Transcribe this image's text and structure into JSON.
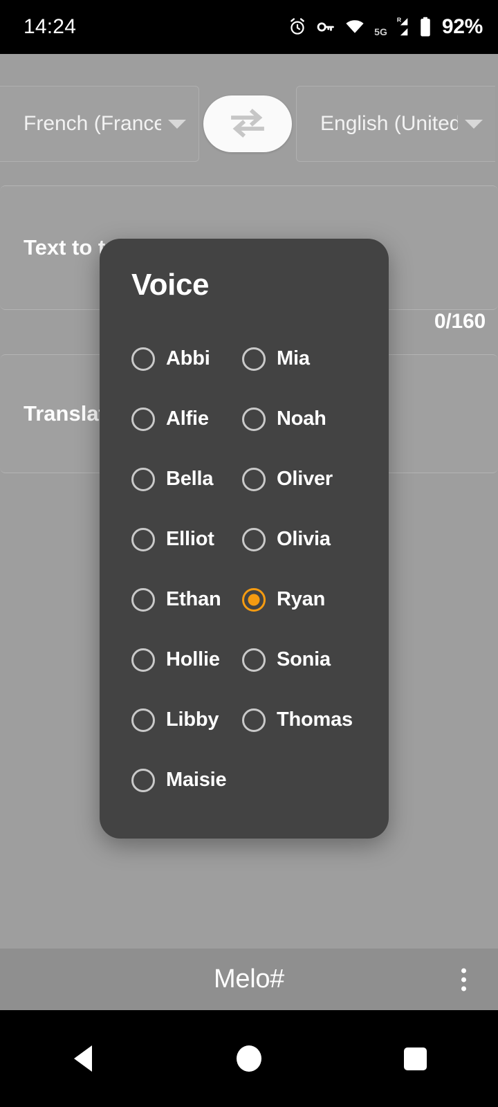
{
  "status_bar": {
    "time": "14:24",
    "battery_percent": "92%",
    "network_label": "5G",
    "roaming_label": "R",
    "icons": [
      "alarm-icon",
      "vpn-key-icon",
      "wifi-icon",
      "signal-5g-icon",
      "battery-icon"
    ]
  },
  "language_bar": {
    "source_language": "French (France)",
    "target_language": "English (United States)",
    "swap_icon": "swap-horizontal-icon"
  },
  "editor": {
    "source_placeholder": "Text to translate",
    "target_placeholder": "Translation",
    "char_counter": "0/160"
  },
  "dialog": {
    "title": "Voice",
    "selected_voice": "Ryan",
    "accent_color": "#f59b11",
    "background_color": "#434343",
    "voices": [
      {
        "label": "Abbi",
        "selected": false
      },
      {
        "label": "Mia",
        "selected": false
      },
      {
        "label": "Alfie",
        "selected": false
      },
      {
        "label": "Noah",
        "selected": false
      },
      {
        "label": "Bella",
        "selected": false
      },
      {
        "label": "Oliver",
        "selected": false
      },
      {
        "label": "Elliot",
        "selected": false
      },
      {
        "label": "Olivia",
        "selected": false
      },
      {
        "label": "Ethan",
        "selected": false
      },
      {
        "label": "Ryan",
        "selected": true
      },
      {
        "label": "Hollie",
        "selected": false
      },
      {
        "label": "Sonia",
        "selected": false
      },
      {
        "label": "Libby",
        "selected": false
      },
      {
        "label": "Thomas",
        "selected": false
      },
      {
        "label": "Maisie",
        "selected": false
      }
    ]
  },
  "app_bar": {
    "title": "Melo#",
    "overflow_icon": "more-vert-icon"
  },
  "nav_bar": {
    "back_icon": "back-triangle-icon",
    "home_icon": "home-circle-icon",
    "recents_icon": "recents-square-icon"
  }
}
